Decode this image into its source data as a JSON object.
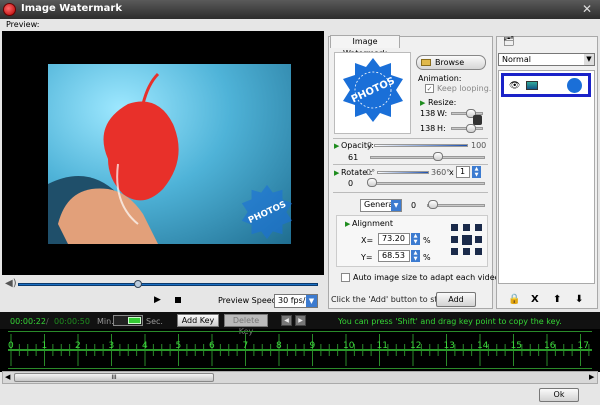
{
  "window": {
    "title": "Image Watermark",
    "close_glyph": "✕"
  },
  "menu": {
    "preview_label": "Preview:"
  },
  "player": {
    "play_glyph": "▶",
    "preview_speed_label": "Preview Speed:",
    "preview_speed_value": "30 fps/s",
    "seek_progress": 0.4
  },
  "watermark_panel": {
    "tab_label": "Image Watermark",
    "stamp_text": "PHOTOS",
    "browse_label": "Browse",
    "animation_label": "Animation:",
    "keep_looping_label": "Keep looping.",
    "keep_looping_checked": true,
    "resize_label": "Resize:",
    "width_value": "138",
    "width_label": "W:",
    "height_value": "138",
    "height_label": "H:",
    "opacity_label": "Opacity:",
    "opacity_min": "0",
    "opacity_max": "100",
    "opacity_value": "61",
    "rotate_label": "Rotate :",
    "rotate_min": "0°",
    "rotate_max": "360°",
    "rotate_multiplier_symbol": "x",
    "rotate_multiplier": "1",
    "rotate_value": "0",
    "general_select": "General",
    "general_value": "0",
    "alignment_label": "Alignment",
    "x_label": "X=",
    "x_value": "73.20",
    "y_label": "Y=",
    "y_value": "68.53",
    "percent": "%",
    "auto_size_label": "Auto image size to adapt each videos.",
    "hint_text": "Click the 'Add' button to start ->",
    "add_label": "Add"
  },
  "layers_panel": {
    "blend_mode": "Normal",
    "tools": [
      "🔒",
      "X",
      "⬆",
      "⬇"
    ]
  },
  "timeline": {
    "current_time": "00:00:22",
    "total_time": "00:00:50",
    "min_label": "Min.",
    "sec_label": "Sec.",
    "add_key_label": "Add Key",
    "delete_key_label": "Delete Key",
    "hint": "You can press 'Shift' and drag key point to copy the key.",
    "ruler_numbers": [
      "0",
      "1",
      "2",
      "3",
      "4",
      "5",
      "6",
      "7",
      "8",
      "9",
      "10",
      "11",
      "12",
      "13",
      "14",
      "15",
      "16",
      "17"
    ],
    "scroll_grip": "III"
  },
  "footer": {
    "ok_label": "Ok"
  },
  "colors": {
    "accent_blue": "#1a22c8",
    "timeline_green": "#35d435",
    "stamp_blue": "#1a6fd8"
  },
  "icons": {
    "app": "app-logo-icon",
    "layer": "layers-icon",
    "eye": "eye-icon",
    "image": "image-thumb-icon"
  }
}
